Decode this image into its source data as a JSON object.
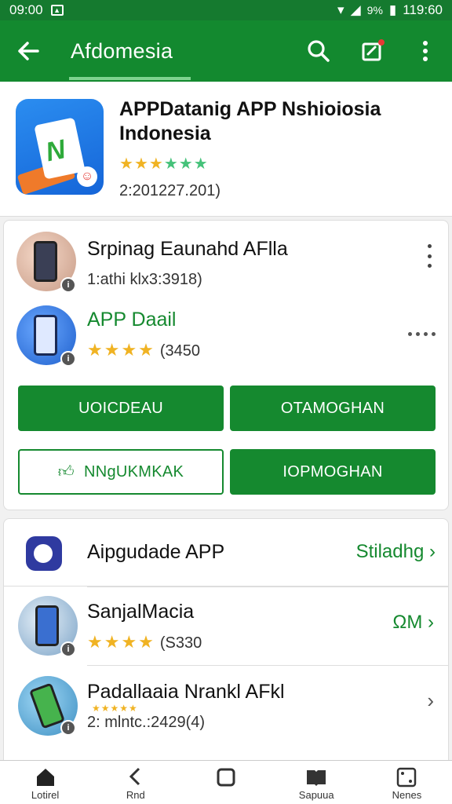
{
  "status": {
    "left_time": "09:00",
    "battery": "9%",
    "time": "119:60"
  },
  "appbar": {
    "title": "Afdomesia"
  },
  "hero": {
    "title": "APPDatanig APP Nshioiosia Indonesia",
    "rating_stars": 3,
    "meta": "2:201227.201)",
    "accent": "#13892f"
  },
  "panel1": {
    "items": [
      {
        "name": "Srpinag Eaunahd AFlla",
        "sub": "1:athi klx3:3918)"
      },
      {
        "name": "APP Daail",
        "stars": 4,
        "count": "(3450"
      }
    ],
    "buttons": {
      "primary_left": "UOICDEAU",
      "primary_right": "OTAMOGHAN",
      "outline_left": "NNgUKMKAK",
      "primary_right2": "IOPMOGHAN"
    }
  },
  "panel2": {
    "title": "Aipgudade APP",
    "link": "Stiladhg",
    "items": [
      {
        "name": "SanjalMacia",
        "stars": 4,
        "count": "(S330",
        "side": "ΩM"
      },
      {
        "name": "Padallaaia Nrankl AFkl",
        "stars": 5,
        "sub": "2: mlntc.:2429(4)"
      }
    ]
  },
  "bottomnav": {
    "items": [
      {
        "label": "Lotirel"
      },
      {
        "label": "Rnd"
      },
      {
        "label": ""
      },
      {
        "label": "Sapuua"
      },
      {
        "label": "Nenes"
      }
    ]
  }
}
